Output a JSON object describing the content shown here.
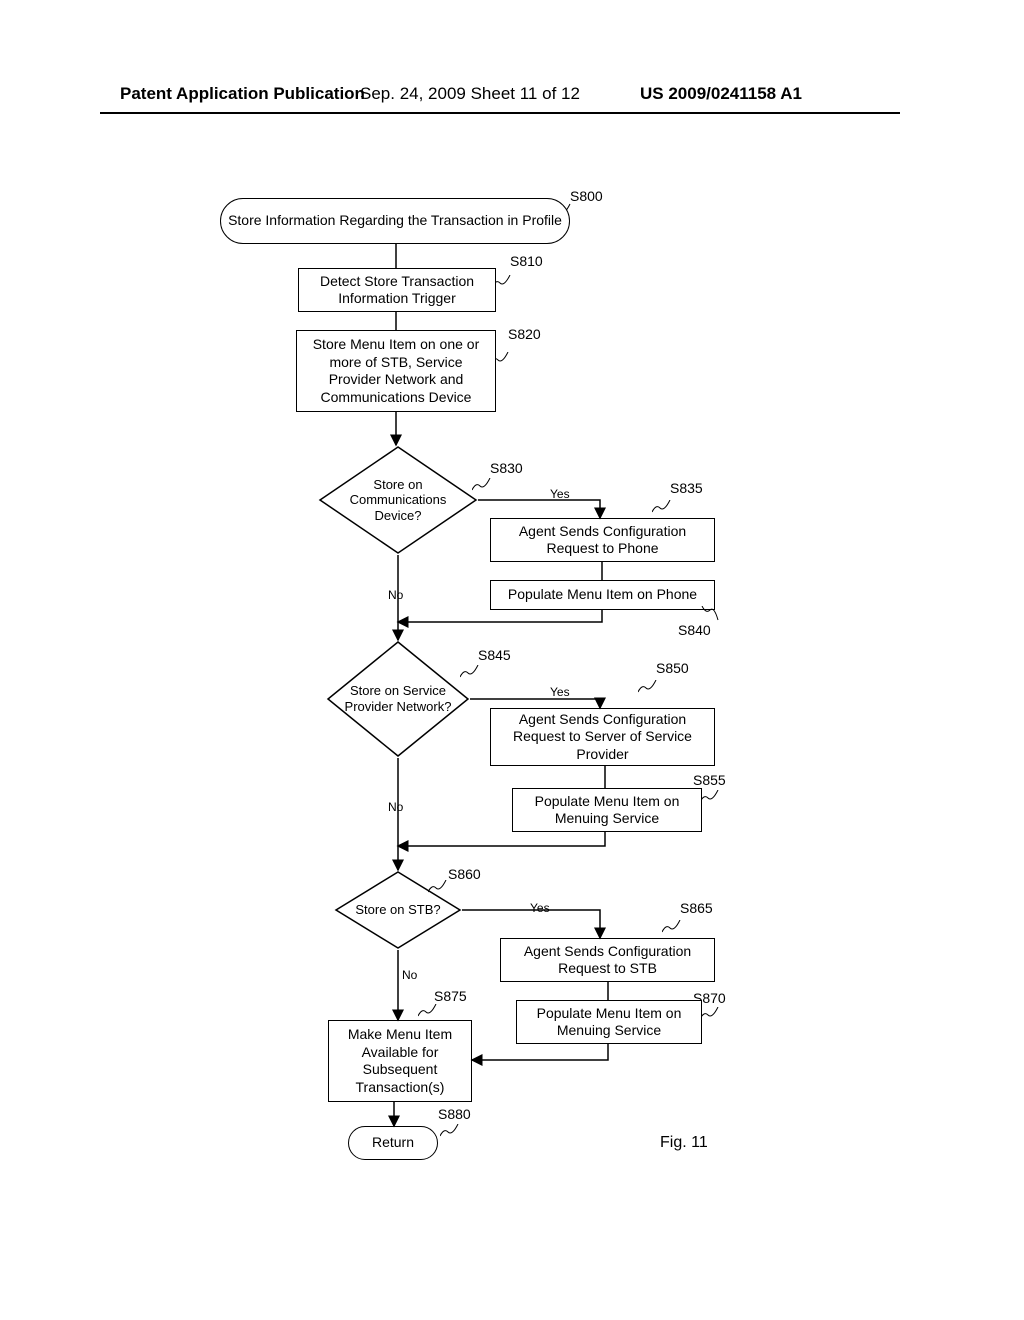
{
  "header": {
    "left": "Patent Application Publication",
    "middle": "Sep. 24, 2009  Sheet 11 of 12",
    "right": "US 2009/0241158 A1"
  },
  "refs": {
    "s800": "S800",
    "s810": "S810",
    "s820": "S820",
    "s830": "S830",
    "s835": "S835",
    "s840": "S840",
    "s845": "S845",
    "s850": "S850",
    "s855": "S855",
    "s860": "S860",
    "s865": "S865",
    "s870": "S870",
    "s875": "S875",
    "s880": "S880"
  },
  "edges": {
    "yes": "Yes",
    "no": "No"
  },
  "figure_label": "Fig. 11",
  "nodes": {
    "start": "Store Information Regarding the Transaction in Profile",
    "s810": "Detect Store Transaction Information Trigger",
    "s820": "Store Menu Item on one or more of STB, Service Provider Network and Communications Device",
    "s830": "Store on Communications Device?",
    "s835": "Agent Sends Configuration Request to Phone",
    "s840": "Populate Menu Item on Phone",
    "s845": "Store on Service Provider Network?",
    "s850": "Agent Sends Configuration Request to Server of Service Provider",
    "s855": "Populate Menu Item on Menuing Service",
    "s860": "Store on STB?",
    "s865": "Agent Sends Configuration Request to STB",
    "s870": "Populate Menu Item on Menuing Service",
    "s875": "Make Menu Item Available for Subsequent Transaction(s)",
    "return": "Return"
  }
}
